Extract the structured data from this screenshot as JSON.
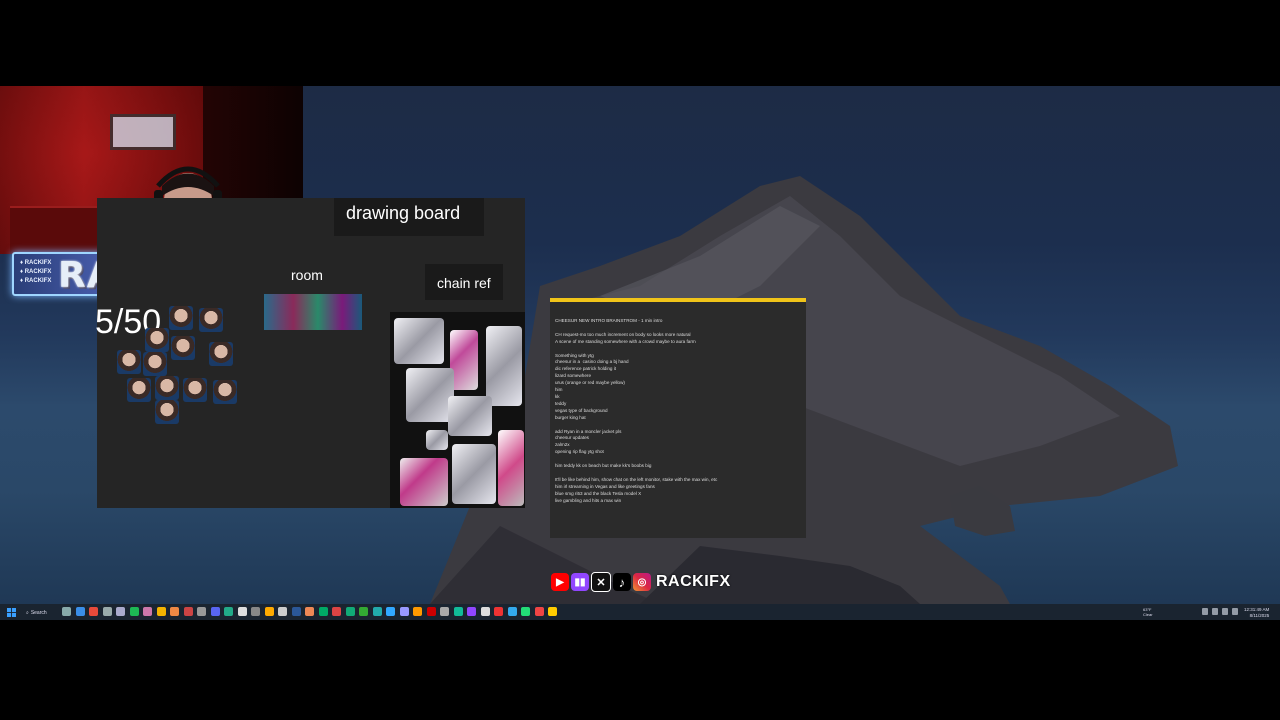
{
  "webcam_logo": {
    "name": "RACKIFX",
    "mini_lines": [
      "♦ RACKIFX",
      "♦ RACKIFX",
      "♦ RACKIFX"
    ]
  },
  "drawing_board": {
    "title": "drawing board",
    "room_label": "room",
    "chain_label": "chain ref",
    "counter": "5/50"
  },
  "notes": {
    "lines": [
      "CHEESUR NEW INTRO BRAINSTROM - 1 min intro",
      "",
      "CH request-mo too much increment on body so looks more natural",
      "A scene of me standing somewhere with a crowd maybe to aura farm",
      "",
      "Something with ytg",
      "cheesur in a  casino doing a bj hand",
      "dic reference patrick holding it",
      "lizard somewhere",
      "urus (orange or red maybe yellow)",
      "him",
      "kk",
      "teddy",
      "vegas type of background",
      "burger king hat",
      "",
      "add Ryan in a moncler jacket pls",
      "cheesur updates",
      "zalm2x",
      "opening rip flag ytg shot",
      "",
      "him teddy kk on beach but make kk's boobs big",
      "",
      "It'll be like behind him, show chat on the left monitor, stake with the max win, etc",
      "him irl streaming in Vegas and like greetings fans",
      "blue smg ri53 and the black Tesla model X",
      "live gambling and hits a max win"
    ]
  },
  "socials": {
    "handle": "RACKIFX",
    "icons": [
      "youtube-icon",
      "twitch-icon",
      "x-icon",
      "tiktok-icon",
      "instagram-icon"
    ],
    "colors": {
      "youtube": "#ff0000",
      "twitch": "#9146ff",
      "x": "#000000",
      "instagram": "#e1306c"
    }
  },
  "taskbar": {
    "search_label": "Search",
    "weather_temp": "63°F",
    "weather_desc": "Clear",
    "time": "12:31:49 AM",
    "date": "8/11/2025"
  },
  "colors": {
    "notes_accent": "#f0c419",
    "board_bg": "#252525",
    "taskbar_bg": "#1a2430"
  }
}
